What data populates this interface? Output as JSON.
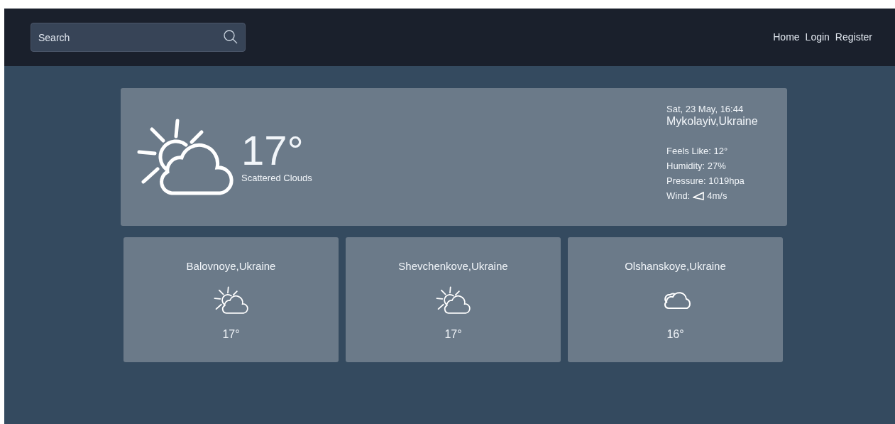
{
  "search": {
    "placeholder": "Search"
  },
  "nav_links": [
    "Home",
    "Login",
    "Register"
  ],
  "current": {
    "kind": "partly-cloudy",
    "temperature": "17°",
    "description": "Scattered Clouds",
    "datetime": "Sat, 23 May, 16:44",
    "location": "Mykolayiv,Ukraine",
    "details": [
      {
        "kind": "text",
        "text": "Feels Like: 12°"
      },
      {
        "kind": "text",
        "text": "Humidity: 27%"
      },
      {
        "kind": "text",
        "text": "Pressure: 1019hpa"
      },
      {
        "kind": "wind",
        "label": "Wind:",
        "text": "4m/s"
      }
    ]
  },
  "cities": [
    {
      "name": "Balovnoye,Ukraine",
      "kind": "partly-cloudy",
      "temperature": "17°"
    },
    {
      "name": "Shevchenkove,Ukraine",
      "kind": "partly-cloudy",
      "temperature": "17°"
    },
    {
      "name": "Olshanskoye,Ukraine",
      "kind": "cloudy",
      "temperature": "16°"
    }
  ]
}
